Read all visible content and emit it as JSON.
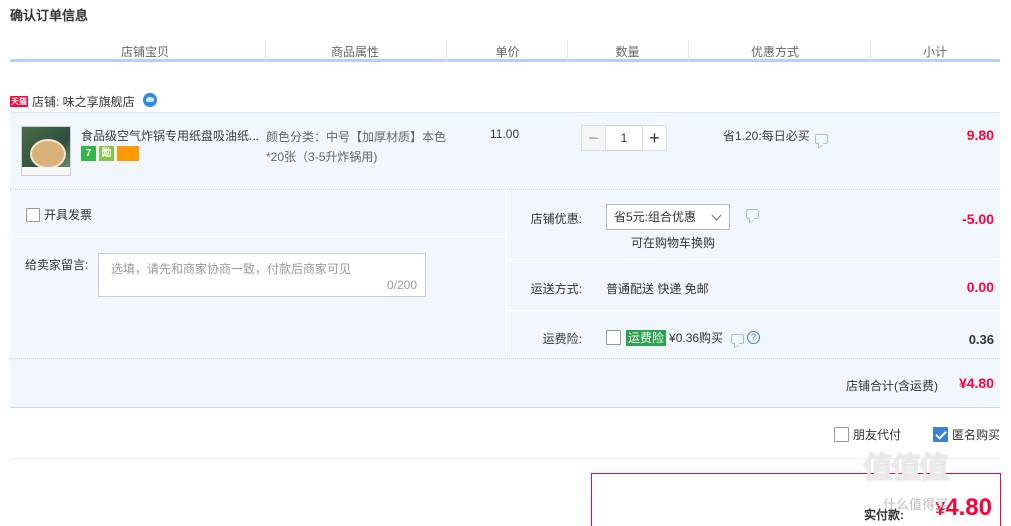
{
  "page": {
    "title": "确认订单信息"
  },
  "columns": [
    "店铺宝贝",
    "商品属性",
    "单价",
    "数量",
    "优惠方式",
    "小计"
  ],
  "shop": {
    "badge": "天猫",
    "label": "店铺: 味之享旗舰店"
  },
  "item": {
    "name": "食品级空气炸锅专用纸盘吸油纸...",
    "badges": [
      "7",
      "勋"
    ],
    "attr_line1": "颜色分类：中号【加厚材质】本色",
    "attr_line2": "*20张（3-5升炸锅用)",
    "price": "11.00",
    "quantity": "1",
    "minus": "−",
    "plus": "+",
    "promo": "省1.20:每日必买",
    "subtotal": "9.80"
  },
  "invoice": {
    "label": "开具发票",
    "checked": false
  },
  "message": {
    "label": "给卖家留言:",
    "placeholder": "选填，请先和商家协商一致，付款后商家可见",
    "counter": "0/200"
  },
  "shop_discount": {
    "label": "店铺优惠:",
    "selected": "省5元:组合优惠",
    "note": "可在购物车换购",
    "value": "-5.00"
  },
  "shipping": {
    "label": "运送方式:",
    "text": "普通配送 快递 免邮",
    "value": "0.00"
  },
  "freight_insurance": {
    "label": "运费险:",
    "tag": "运费险",
    "text": "¥0.36购买",
    "help": "?",
    "value": "0.36"
  },
  "shop_total": {
    "label": "店铺合计(含运费)",
    "value": "¥4.80"
  },
  "options": {
    "friend_pay": "朋友代付",
    "friend_pay_checked": false,
    "anonymous": "匿名购买",
    "anonymous_checked": true
  },
  "payment": {
    "label": "实付款:",
    "currency": "¥",
    "value": "4.80"
  },
  "watermark": {
    "brand": "值值值",
    "site": "什么值得买"
  },
  "colors": {
    "accent_red": "#ff0036",
    "light_blue_bg": "#f2f7ff",
    "header_underline": "#b2d1ff",
    "insurance_green": "#2aa34a"
  }
}
